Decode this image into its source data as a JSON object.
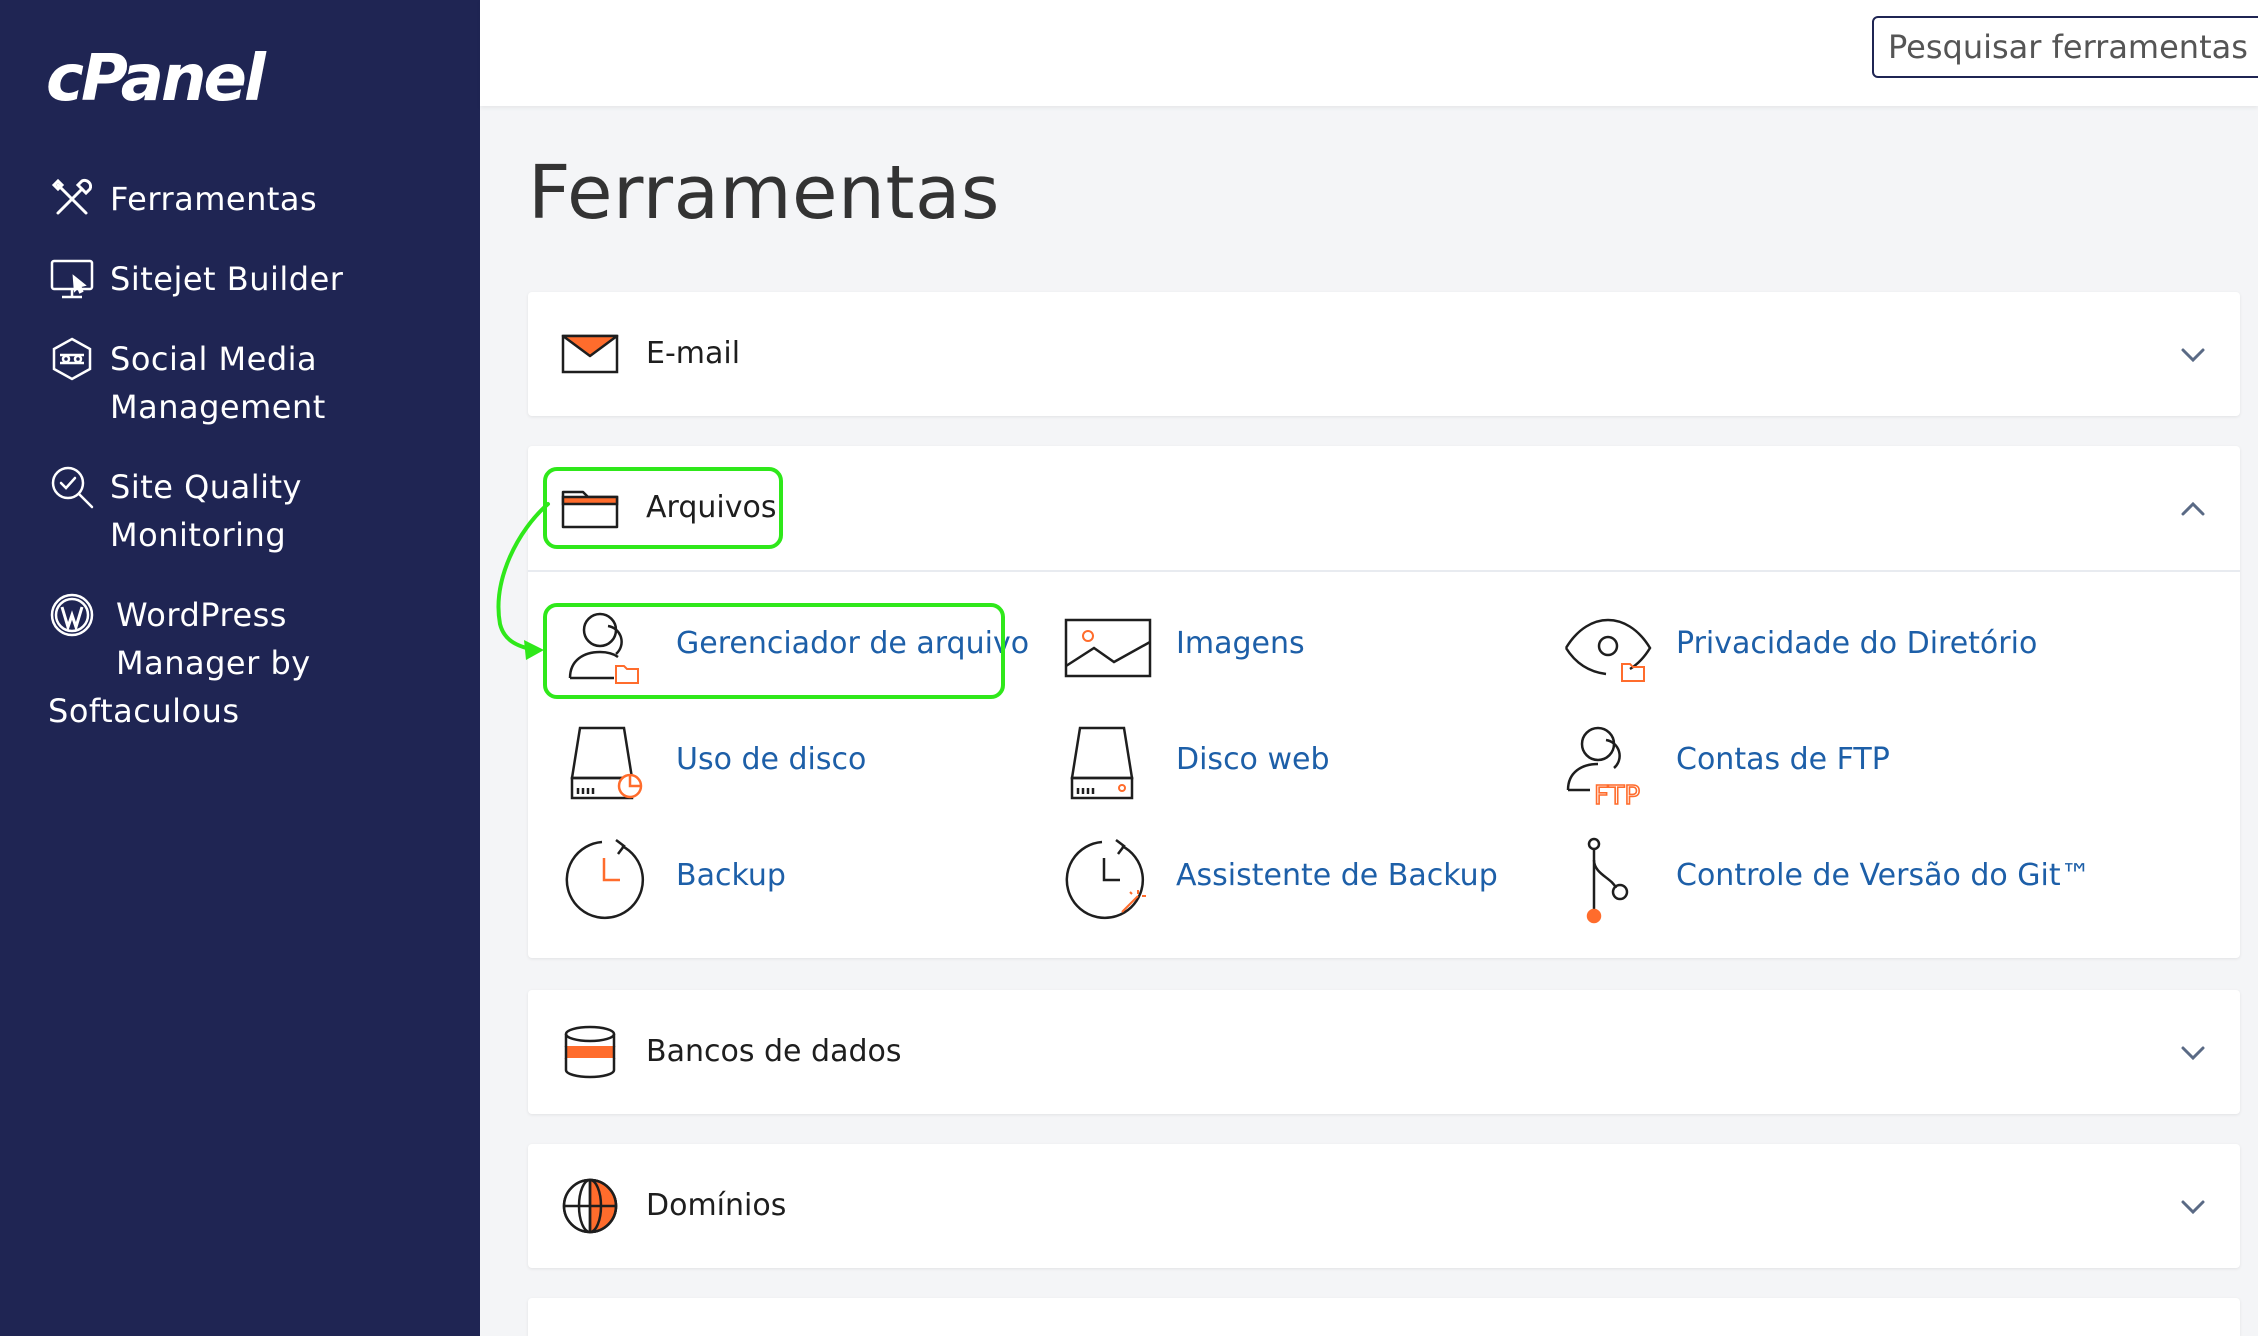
{
  "app": {
    "logo": "cPanel"
  },
  "sidebar": {
    "items": [
      {
        "label": "Ferramentas",
        "icon": "tools-icon"
      },
      {
        "label": "Sitejet Builder",
        "icon": "monitor-icon"
      },
      {
        "label": "Social Media Management",
        "icon": "social-media-icon"
      },
      {
        "label": "Site Quality Monitoring",
        "icon": "magnifier-check-icon"
      },
      {
        "label_line1": "WordPress",
        "label_line2": "Manager by",
        "label_line3": "Softaculous",
        "icon": "wordpress-icon"
      }
    ]
  },
  "search": {
    "placeholder": "Pesquisar ferramentas (/)"
  },
  "main": {
    "title": "Ferramentas",
    "sections": [
      {
        "title": "E-mail",
        "icon": "envelope-icon",
        "expanded": false
      },
      {
        "title": "Arquivos",
        "icon": "folder-icon",
        "expanded": true,
        "tools": [
          {
            "label": "Gerenciador de arquivo",
            "icon": "file-manager-icon"
          },
          {
            "label": "Imagens",
            "icon": "image-icon"
          },
          {
            "label": "Privacidade do Diretório",
            "icon": "eye-folder-icon"
          },
          {
            "label": "Uso de disco",
            "icon": "disk-usage-icon"
          },
          {
            "label": "Disco web",
            "icon": "web-disk-icon"
          },
          {
            "label": "Contas de FTP",
            "icon": "ftp-accounts-icon"
          },
          {
            "label": "Backup",
            "icon": "backup-clock-icon"
          },
          {
            "label": "Assistente de Backup",
            "icon": "backup-wizard-icon"
          },
          {
            "label": "Controle de Versão do Git™",
            "icon": "git-icon"
          }
        ]
      },
      {
        "title": "Bancos de dados",
        "icon": "database-icon",
        "expanded": false
      },
      {
        "title": "Domínios",
        "icon": "globe-icon",
        "expanded": false
      }
    ]
  },
  "colors": {
    "sidebar_bg": "#1f2553",
    "accent_orange": "#ff6c2c",
    "link_blue": "#1d5fa8",
    "highlight_green": "#2fe81a"
  }
}
